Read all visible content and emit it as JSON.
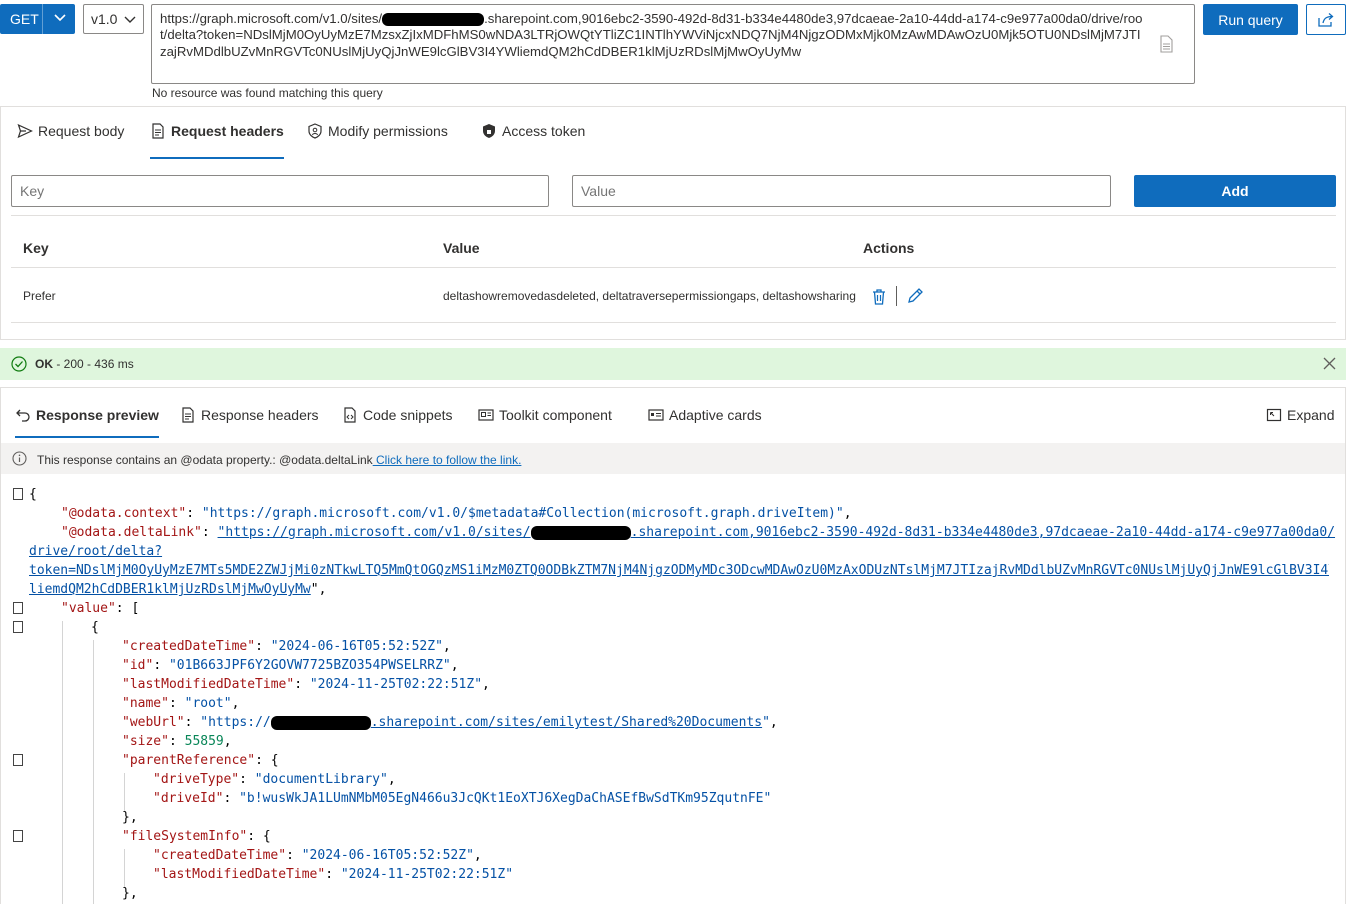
{
  "query": {
    "method": "GET",
    "version": "v1.0",
    "url_prefix": "https://graph.microsoft.com/v1.0/sites/",
    "url_suffix": ".sharepoint.com,9016ebc2-3590-492d-8d31-b334e4480de3,97dcaeae-2a10-44dd-a174-c9e977a00da0/drive/root/delta?token=NDslMjM0OyUyMzE7MzsxZjIxMDFhMS0wNDA3LTRjOWQtYTliZC1INTlhYWViNjcxNDQ7NjM4NjgzODMxMjk0MzAwMDAwOzU0Mjk5OTU0NDslMjM7JTIzajRvMDdlbUZvMnRGVTc0NUslMjUyQjJnWE9lcGlBV3I4YWliemdQM2hCdDBER1klMjUzRDslMjMwOyUyMw",
    "hint": "No resource was found matching this query",
    "run_label": "Run query"
  },
  "request": {
    "tabs": [
      "Request body",
      "Request headers",
      "Modify permissions",
      "Access token"
    ],
    "active_tab": "Request headers",
    "key_placeholder": "Key",
    "value_placeholder": "Value",
    "add_label": "Add",
    "columns": [
      "Key",
      "Value",
      "Actions"
    ],
    "rows": [
      {
        "key": "Prefer",
        "value": "deltashowremovedasdeleted, deltatraversepermissiongaps, deltashowsharing"
      }
    ]
  },
  "status": {
    "ok": "OK",
    "detail": " - 200 - 436 ms",
    "color": "#dff6dd"
  },
  "response": {
    "tabs": [
      "Response preview",
      "Response headers",
      "Code snippets",
      "Toolkit component",
      "Adaptive cards"
    ],
    "active_tab": "Response preview",
    "expand_label": "Expand",
    "info_text": "This response contains an @odata property.: @odata.deltaLink",
    "info_link": " Click here to follow the link."
  },
  "json": {
    "open_brace": "{",
    "context_key": "\"@odata.context\"",
    "context_val": "\"https://graph.microsoft.com/v1.0/$metadata#Collection(microsoft.graph.driveItem)\"",
    "delta_key": "\"@odata.deltaLink\"",
    "delta_val_1a": "\"https://graph.microsoft.com/v1.0/sites/",
    "delta_val_1b": ".sharepoint.com,9016ebc2-3590-492d-8d31-b334e4480de3,97dcaeae-2a10-44dd-a174-c9e977a00da0/",
    "delta_val_2": "drive/root/delta?",
    "delta_val_3": "token=NDslMjM0OyUyMzE7MTs5MDE2ZWJjMi0zNTkwLTQ5MmQtOGQzMS1iMzM0ZTQ0ODBkZTM7NjM4NjgzODMyMDc3ODcwMDAwOzU0MzAxODUzNTslMjM7JTIzajRvMDdlbUZvMnRGVTc0NUslMjUyQjJnWE9lcGlBV3I4YWliemdQM2hCdDBER1klMjUzRDslMjMwOyUyMw\"",
    "delta_val_3_split": "liemdQM2hCdDBER1klMjUzRDslMjMwOyUyMw",
    "value_key": "\"value\"",
    "created_key": "\"createdDateTime\"",
    "created_val": "\"2024-06-16T05:52:52Z\"",
    "id_key": "\"id\"",
    "id_val": "\"01B663JPF6Y2GOVW7725BZO354PWSELRRZ\"",
    "lastmod_key": "\"lastModifiedDateTime\"",
    "lastmod_val": "\"2024-11-25T02:22:51Z\"",
    "name_key": "\"name\"",
    "name_val": "\"root\"",
    "weburl_key": "\"webUrl\"",
    "weburl_a": "\"https://",
    "weburl_b": ".sharepoint.com/sites/emilytest/Shared%20Documents",
    "weburl_c": "\"",
    "size_key": "\"size\"",
    "size_val": "55859",
    "parent_key": "\"parentReference\"",
    "drivetype_key": "\"driveType\"",
    "drivetype_val": "\"documentLibrary\"",
    "driveid_key": "\"driveId\"",
    "driveid_val": "\"b!wusWkJA1LUmNMbM05EgN466u3JcQKt1EoXTJ6XegDaChASEfBwSdTKm95ZqutnFE\"",
    "fsi_key": "\"fileSystemInfo\"",
    "fsi_created_key": "\"createdDateTime\"",
    "fsi_created_val": "\"2024-06-16T05:52:52Z\"",
    "fsi_lastmod_key": "\"lastModifiedDateTime\"",
    "fsi_lastmod_val": "\"2024-11-25T02:22:51Z\""
  }
}
